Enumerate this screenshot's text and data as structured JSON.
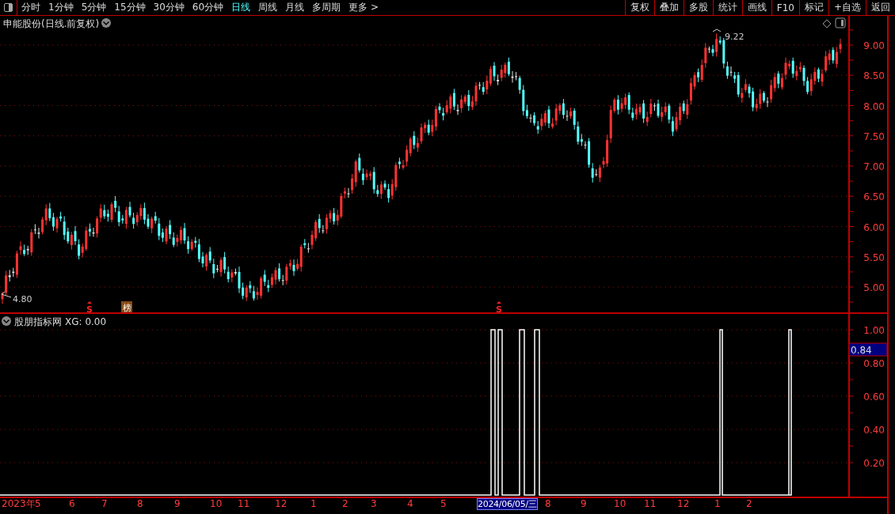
{
  "toolbar": {
    "tabs": [
      {
        "label": "分时",
        "selected": false
      },
      {
        "label": "1分钟",
        "selected": false
      },
      {
        "label": "5分钟",
        "selected": false
      },
      {
        "label": "15分钟",
        "selected": false
      },
      {
        "label": "30分钟",
        "selected": false
      },
      {
        "label": "60分钟",
        "selected": false
      },
      {
        "label": "日线",
        "selected": true
      },
      {
        "label": "周线",
        "selected": false
      },
      {
        "label": "月线",
        "selected": false
      },
      {
        "label": "多周期",
        "selected": false
      },
      {
        "label": "更多 >",
        "selected": false
      }
    ],
    "buttons": [
      "复权",
      "叠加",
      "多股",
      "统计",
      "画线",
      "F10",
      "标记",
      "+自选",
      "返回"
    ]
  },
  "price_panel": {
    "title": "申能股份(日线.前复权)",
    "high_marker": "9.22",
    "low_marker": "4.80",
    "axis_labels": [
      "9.00",
      "8.50",
      "8.00",
      "7.50",
      "7.00",
      "6.50",
      "6.00",
      "5.50",
      "5.00"
    ],
    "signals": [
      {
        "kind": "sell",
        "text": "S"
      },
      {
        "kind": "list",
        "text": "榜"
      },
      {
        "kind": "sell",
        "text": "S"
      }
    ]
  },
  "indicator_panel": {
    "title": "股朋指标网",
    "reading": "XG: 0.00",
    "cursor_value": "0.84",
    "axis_labels": [
      "1.00",
      "0.80",
      "0.60",
      "0.40",
      "0.20"
    ]
  },
  "date_axis": {
    "labels": [
      {
        "text": "2023年",
        "highlighted": false
      },
      {
        "text": "5",
        "highlighted": false
      },
      {
        "text": "6",
        "highlighted": false
      },
      {
        "text": "7",
        "highlighted": false
      },
      {
        "text": "8",
        "highlighted": false
      },
      {
        "text": "9",
        "highlighted": false
      },
      {
        "text": "10",
        "highlighted": false
      },
      {
        "text": "11",
        "highlighted": false
      },
      {
        "text": "12",
        "highlighted": false
      },
      {
        "text": "1",
        "highlighted": false
      },
      {
        "text": "2",
        "highlighted": false
      },
      {
        "text": "3",
        "highlighted": false
      },
      {
        "text": "4",
        "highlighted": false
      },
      {
        "text": "5",
        "highlighted": false
      },
      {
        "text": "2024/06/05/三",
        "highlighted": true
      },
      {
        "text": "8",
        "highlighted": false
      },
      {
        "text": "9",
        "highlighted": false
      },
      {
        "text": "10",
        "highlighted": false
      },
      {
        "text": "11",
        "highlighted": false
      },
      {
        "text": "12",
        "highlighted": false
      },
      {
        "text": "1",
        "highlighted": false
      },
      {
        "text": "2",
        "highlighted": false
      }
    ]
  }
}
